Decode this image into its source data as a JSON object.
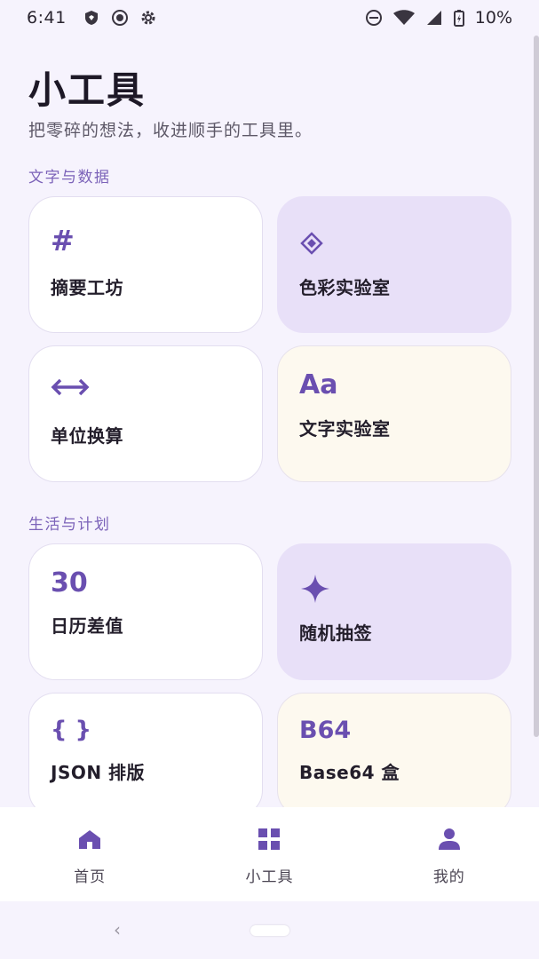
{
  "status_bar": {
    "time": "6:41",
    "battery": "10%",
    "icons_left": [
      "shield-icon",
      "record-icon",
      "gear-icon"
    ],
    "icons_right": [
      "do-not-disturb-icon",
      "wifi-icon",
      "signal-icon",
      "battery-icon"
    ]
  },
  "header": {
    "title": "小工具",
    "subtitle": "把零碎的想法，收进顺手的工具里。"
  },
  "sections": [
    {
      "label": "文字与数据",
      "cards": [
        {
          "icon_text": "#",
          "icon": "hash-icon",
          "label": "摘要工坊"
        },
        {
          "icon_text": "",
          "icon": "diamond-icon",
          "label": "色彩实验室"
        },
        {
          "icon_text": "",
          "icon": "arrows-horizontal-icon",
          "label": "单位换算"
        },
        {
          "icon_text": "Aa",
          "icon": "font-icon",
          "label": "文字实验室"
        }
      ]
    },
    {
      "label": "生活与计划",
      "cards": [
        {
          "icon_text": "30",
          "icon": "calendar-number-icon",
          "label": "日历差值"
        },
        {
          "icon_text": "",
          "icon": "sparkle-icon",
          "label": "随机抽签"
        },
        {
          "icon_text": "{ }",
          "icon": "braces-icon",
          "label": "JSON 排版"
        },
        {
          "icon_text": "B64",
          "icon": "base64-icon",
          "label": "Base64 盒"
        }
      ]
    }
  ],
  "bottom_nav": {
    "items": [
      {
        "label": "首页",
        "icon": "home-icon"
      },
      {
        "label": "小工具",
        "icon": "grid-icon"
      },
      {
        "label": "我的",
        "icon": "person-icon"
      }
    ]
  },
  "system_nav": {
    "back_glyph": "‹"
  },
  "colors": {
    "background": "#f6f3fd",
    "accent": "#6a4fb0",
    "card_purple": "#e8e0f8",
    "card_cream": "#fdf9ef",
    "card_white": "#ffffff"
  }
}
